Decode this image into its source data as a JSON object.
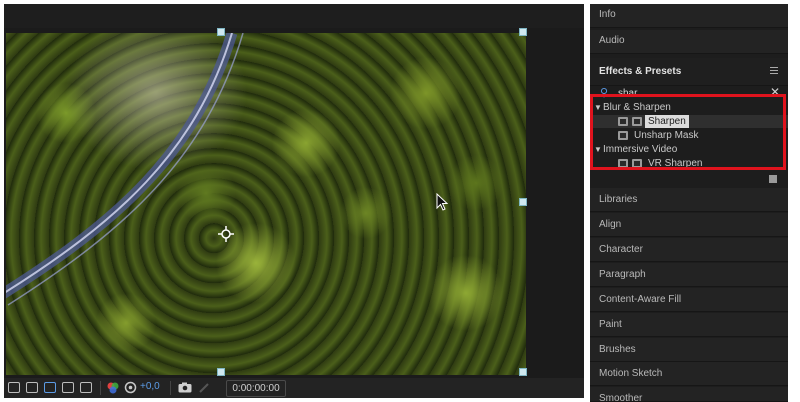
{
  "viewer": {
    "exposure": "+0,0",
    "timecode": "0:00:00:00"
  },
  "panel": {
    "tabs_top": [
      {
        "label": "Info"
      },
      {
        "label": "Audio"
      }
    ],
    "effects": {
      "title": "Effects & Presets",
      "search_value": "shar",
      "tree": [
        {
          "type": "category",
          "label": "Blur & Sharpen"
        },
        {
          "type": "effect",
          "label": "Sharpen",
          "selected": true,
          "badges": 2
        },
        {
          "type": "effect",
          "label": "Unsharp Mask",
          "selected": false,
          "badges": 1
        },
        {
          "type": "category",
          "label": "Immersive Video"
        },
        {
          "type": "effect",
          "label": "VR Sharpen",
          "selected": false,
          "badges": 2
        }
      ]
    },
    "tabs_bottom": [
      {
        "label": "Libraries"
      },
      {
        "label": "Align"
      },
      {
        "label": "Character"
      },
      {
        "label": "Paragraph"
      },
      {
        "label": "Content-Aware Fill"
      },
      {
        "label": "Paint"
      },
      {
        "label": "Brushes"
      },
      {
        "label": "Motion Sketch"
      },
      {
        "label": "Smoother"
      }
    ]
  },
  "colors": {
    "highlight": "#e0131d",
    "accent": "#5c9be6"
  }
}
